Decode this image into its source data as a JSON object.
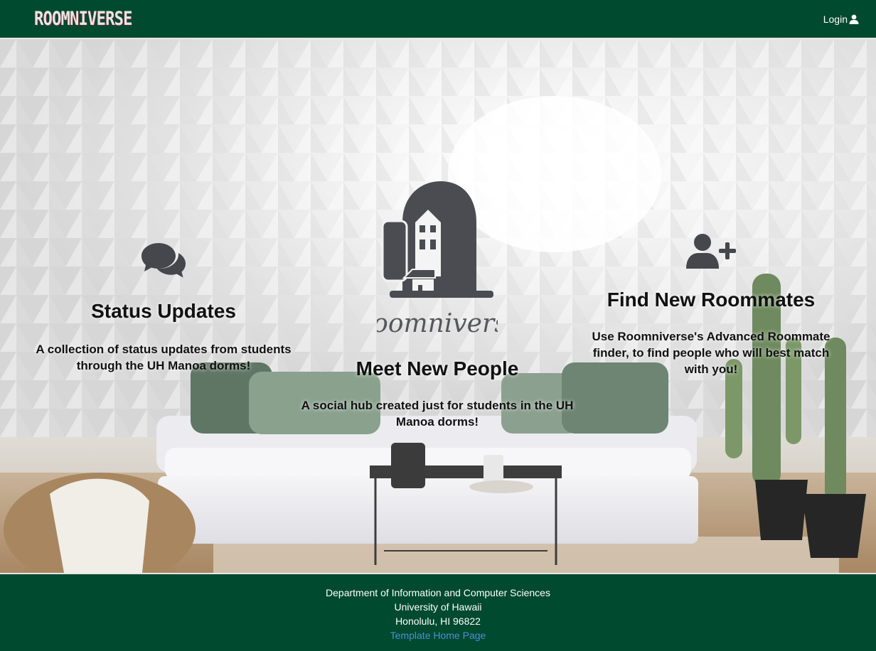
{
  "navbar": {
    "brand": "ROOMNIVERSE",
    "login_label": "Login",
    "login_icon": "user-icon"
  },
  "features": {
    "status": {
      "icon": "comments-icon",
      "title": "Status Updates",
      "description": "A collection of status updates from students through the UH Manoa dorms!"
    },
    "center": {
      "logo_text": "Roomniverse",
      "title": "Meet New People",
      "description": "A social hub created just for students in the UH Manoa dorms!"
    },
    "roommates": {
      "icon": "user-plus-icon",
      "title": "Find New Roommates",
      "description": "Use Roomniverse's Advanced Roommate finder, to find people who will best match with you!"
    }
  },
  "footer": {
    "department": "Department of Information and Computer Sciences",
    "university": "University of Hawaii",
    "address": "Honolulu, HI 96822",
    "link_label": "Template Home Page"
  },
  "colors": {
    "nav_bg": "#004a30",
    "footer_bg": "#004a30",
    "link": "#4a8fd8",
    "icon": "#45474c"
  }
}
